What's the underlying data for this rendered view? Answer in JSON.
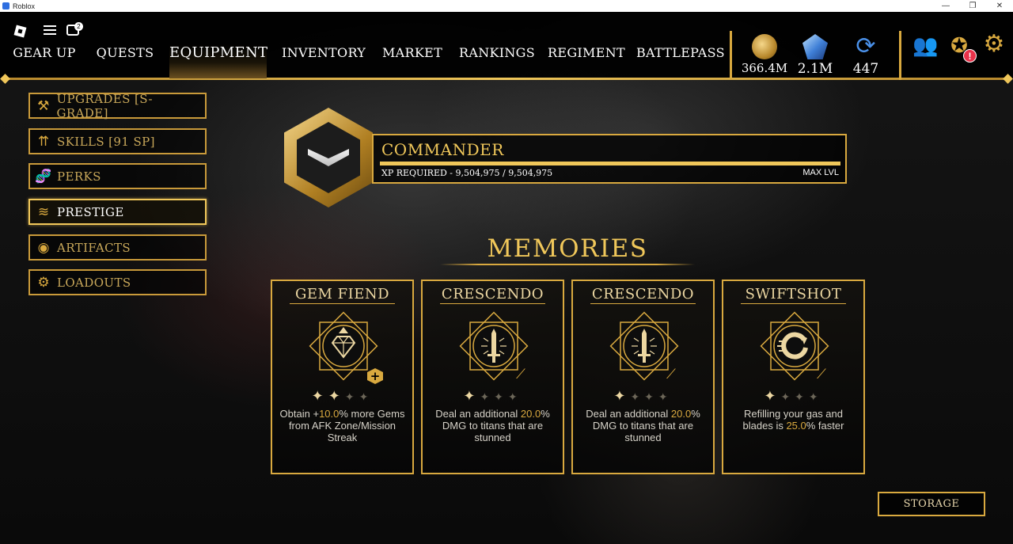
{
  "window": {
    "title": "Roblox",
    "controls": [
      "—",
      "❐",
      "✕"
    ]
  },
  "roblox_menu": {
    "chat_badge_count": "2"
  },
  "nav": {
    "tabs": [
      {
        "label": "GEAR UP"
      },
      {
        "label": "QUESTS"
      },
      {
        "label": "EQUIPMENT",
        "active": true
      },
      {
        "label": "INVENTORY"
      },
      {
        "label": "MARKET"
      },
      {
        "label": "RANKINGS"
      },
      {
        "label": "REGIMENT"
      },
      {
        "label": "BATTLEPASS"
      }
    ]
  },
  "currencies": [
    {
      "icon": "gold-coin-icon",
      "value": "366.4M"
    },
    {
      "icon": "gem-icon",
      "value": "2.1M"
    },
    {
      "icon": "refresh-token-icon",
      "value": "447"
    }
  ],
  "right_icons": {
    "friends": "friends-icon",
    "achievements": "laurel-badge-icon",
    "settings": "gear-icon",
    "alert": "!"
  },
  "sidebar": {
    "items": [
      {
        "label": "UPGRADES [S- GRADE]",
        "icon": "anvil-icon"
      },
      {
        "label": "SKILLS [91 SP]",
        "icon": "skill-arrows-icon"
      },
      {
        "label": "PERKS",
        "icon": "dna-icon"
      },
      {
        "label": "PRESTIGE",
        "icon": "chevron-rank-icon",
        "active": true
      },
      {
        "label": "ARTIFACTS",
        "icon": "artifact-icon"
      },
      {
        "label": "LOADOUTS",
        "icon": "loadout-gear-icon"
      }
    ]
  },
  "rank": {
    "name": "COMMANDER",
    "xp_text": "XP REQUIRED - 9,504,975 / 9,504,975",
    "level_text": "MAX LVL",
    "progress": 1.0
  },
  "memories": {
    "title": "MEMORIES",
    "cards": [
      {
        "title": "GEM FIEND",
        "stars": 2,
        "max_stars": 4,
        "desc_pre": "Obtain +",
        "desc_value": "10.0",
        "desc_post": "% more Gems from AFK Zone/Mission Streak",
        "emblem": "diamond-emblem-icon"
      },
      {
        "title": "CRESCENDO",
        "stars": 1,
        "max_stars": 4,
        "desc_pre": "Deal an additional ",
        "desc_value": "20.0",
        "desc_post": "% DMG to titans that are stunned",
        "emblem": "sword-emblem-icon"
      },
      {
        "title": "CRESCENDO",
        "stars": 1,
        "max_stars": 4,
        "desc_pre": "Deal an additional ",
        "desc_value": "20.0",
        "desc_post": "% DMG to titans that are stunned",
        "emblem": "sword-emblem-icon"
      },
      {
        "title": "SWIFTSHOT",
        "stars": 1,
        "max_stars": 4,
        "desc_pre": "Refilling your gas and blades is ",
        "desc_value": "25.0",
        "desc_post": "% faster",
        "emblem": "gas-refill-emblem-icon"
      }
    ]
  },
  "storage_button": "STORAGE"
}
